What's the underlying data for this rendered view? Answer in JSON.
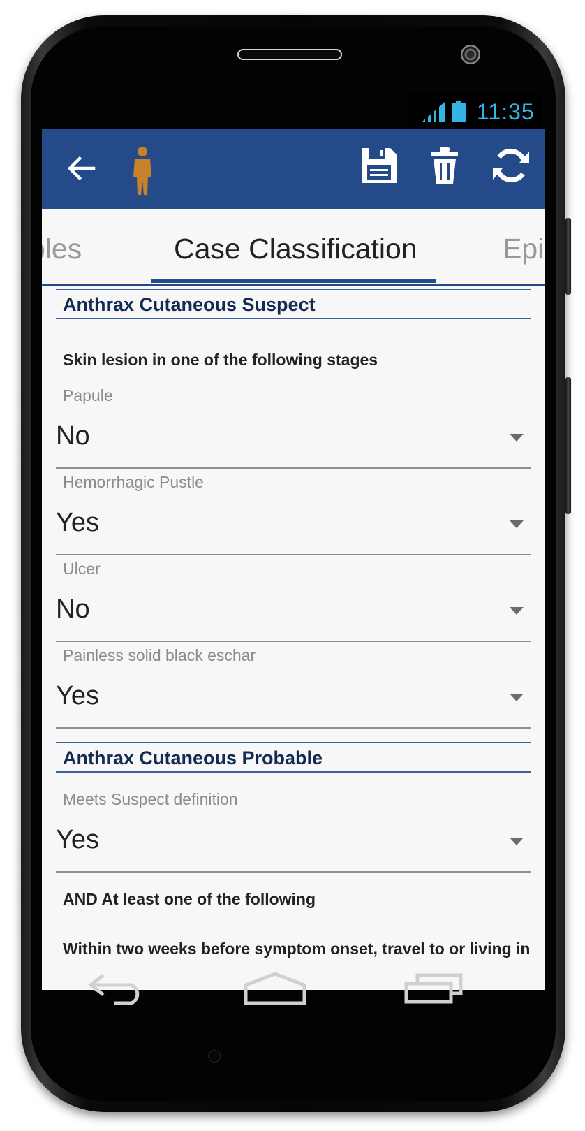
{
  "status_bar": {
    "time": "11:35",
    "icons": [
      "signal-icon",
      "battery-icon"
    ]
  },
  "app_bar": {
    "icons": [
      "arrow-back-icon",
      "person-icon",
      "save-icon",
      "trash-icon",
      "refresh-icon"
    ]
  },
  "tabs": {
    "prev_label": "ples",
    "active_label": "Case Classification",
    "next_label": "Epic"
  },
  "sections": {
    "suspect": {
      "title": "Anthrax Cutaneous Suspect",
      "instruction": "Skin lesion in one of the following stages",
      "fields": [
        {
          "label": "Papule",
          "value": "No"
        },
        {
          "label": "Hemorrhagic Pustle",
          "value": "Yes"
        },
        {
          "label": "Ulcer",
          "value": "No"
        },
        {
          "label": "Painless solid black eschar",
          "value": "Yes"
        }
      ]
    },
    "probable": {
      "title": "Anthrax Cutaneous Probable",
      "fields": [
        {
          "label": "Meets Suspect definition",
          "value": "Yes"
        }
      ],
      "instruction_1": "AND At least one of the following",
      "instruction_2": "Within two weeks before symptom onset, travel to or living in"
    }
  },
  "nav_bar": {
    "icons": [
      "nav-back-icon",
      "nav-home-icon",
      "nav-recents-icon"
    ]
  },
  "colors": {
    "app_bar": "#244a89",
    "status_text": "#33b5e5",
    "section_title": "#132a52",
    "screen_bg": "#f7f7f7"
  }
}
